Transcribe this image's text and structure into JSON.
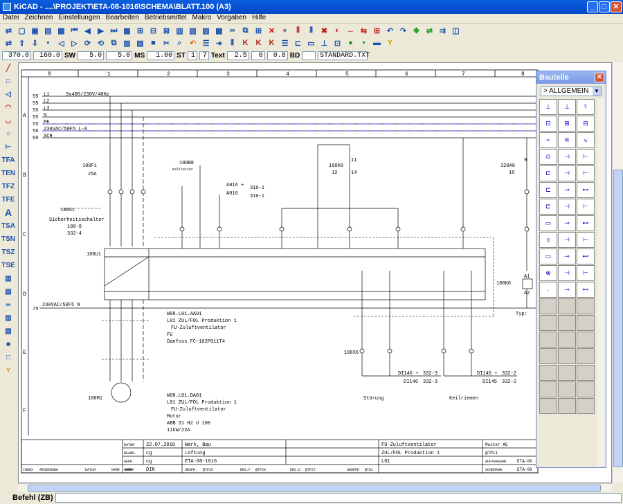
{
  "window": {
    "title": "KiCAD - ....\\PROJEKT\\ETA-08-1016\\SCHEMA\\BLATT.100 (A3)"
  },
  "menu": [
    "Datei",
    "Zeichnen",
    "Einstellungen",
    "Bearbeiten",
    "Betriebsmittel",
    "Makro",
    "Vorgaben",
    "Hilfe"
  ],
  "status_fields": {
    "x": "370.0",
    "y": "160.0",
    "sw_label": "SW",
    "sw1": "5.0",
    "sw2": "5.0",
    "ms_label": "MS",
    "ms": "1.00",
    "st_label": "ST",
    "st1": "1",
    "st2": "7",
    "text_label": "Text",
    "text1": "2.5",
    "text2": "0",
    "text3": "0.8",
    "bd_label": "BD",
    "bd": "",
    "file": "STANDARD.TXT"
  },
  "left_tools": [
    "TFA",
    "TEN",
    "TFZ",
    "TFE",
    "A",
    "TSA",
    "TSN",
    "TSZ",
    "TSE"
  ],
  "columns": [
    "0",
    "1",
    "2",
    "3",
    "4",
    "5",
    "6",
    "7",
    "8"
  ],
  "rows": [
    "A",
    "B",
    "C",
    "D",
    "E",
    "F"
  ],
  "bus": [
    "L1",
    "L2",
    "L3",
    "N",
    "PE",
    "230VAC/50F5 L-8",
    "SCH"
  ],
  "bus_nums": [
    "55",
    "55",
    "55",
    "55",
    "55",
    "56",
    "60"
  ],
  "bus_header": "3x400/230V/40Hz",
  "labels": {
    "f1": "100F1",
    "f1a": "25A",
    "b8": "100B8",
    "b8s": "Kaltleiter",
    "k8": "100K8",
    "k8n": "12",
    "k8n2": "14",
    "k8n3": "11",
    "ad": "320A0",
    "ad1": "10",
    "ad2": "9",
    "x6": "100X6",
    "s1": "100S1",
    "s1t": "Sicherheitsschalter",
    "s1a": "100-8",
    "s1b": "332-4",
    "u1": "100U1",
    "m1": "100M1",
    "a016a": "A016 +",
    "a016b": "A016",
    "ref1": "310-1",
    "ref2": "310-1",
    "wa1": "W08.L01.AA01",
    "wa2": "L01 ZUL/FOL Produktion 1",
    "wa3": "FU-Zuluftventilator",
    "wa4": "FU",
    "wa5": "Danfoss FC-102P011T4",
    "wd1": "W08.L01.DA01",
    "wd2": "L01 ZUL/FOL Produktion 1",
    "wd3": "FU-Zuluftventilator",
    "wd4": "Motor",
    "wd5": "ABB 31 H2 U 100",
    "wd6": "11kW/22A",
    "n230": "230VAC/50F5 N",
    "n75": "75",
    "stoerung": "Störung",
    "keil": "Keilriemen",
    "typ": "Typ:",
    "di1": "DI146 +",
    "di2": "DI146",
    "di3": "DI145 +",
    "di4": "DI145",
    "r1": "332-3",
    "r2": "332-3",
    "r3": "332-2",
    "r4": "332-2",
    "k8b": "100K8",
    "k8b1": "A1",
    "k8b2": "A2"
  },
  "titleblock": {
    "datum_l": "DATUM",
    "datum": "22.07.2010",
    "bearb_l": "BEARB.",
    "bearb": "cg",
    "gepr_l": "GEPR.",
    "gepr": "cg",
    "norm_l": "NORM",
    "norm": "DIN",
    "c1": "Werk, Bau",
    "c2": "Lüftung",
    "c3": "ETA-08-1016",
    "d1": "FU-Zuluftventilator",
    "d2": "ZUL/FOL Produktion 1",
    "d3": "L01",
    "e1": "Muster AG",
    "e2": "@TP11",
    "e3l": "AUFTRAGSNR.",
    "e3": "ETA-08",
    "e4l": "SCHEMANR.",
    "e4": "ETA-08",
    "f1": "INDEX",
    "f2": "AENDERUNG",
    "f3": "DATUM",
    "f4": "NAME",
    "f5": "NORM",
    "f6": "URSPR.",
    "f6v": "@TP25",
    "f7": "ERS.F",
    "f7v": "@TP26",
    "f8": "ERS.D",
    "f8v": "@TP27",
    "f9": "GRUPPE",
    "f9v": "@TU1"
  },
  "panel": {
    "title": "Bauteile",
    "selected": "> ALLGEMEIN"
  },
  "statusbar": {
    "cmd": "Befehl (ZB)"
  }
}
